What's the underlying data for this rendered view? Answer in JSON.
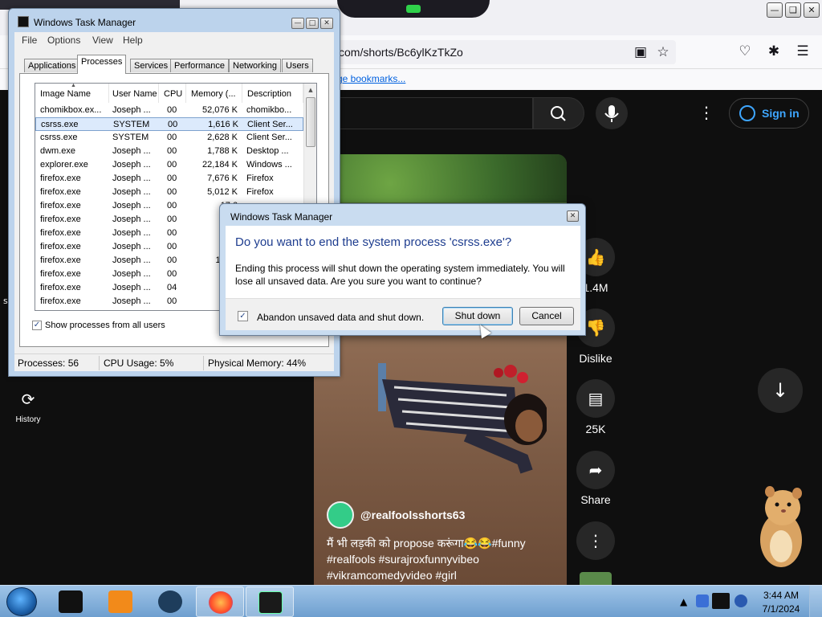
{
  "browser": {
    "url": "com/shorts/Bc6ylKzTkZo",
    "bookmarks_link": "ge bookmarks..."
  },
  "youtube": {
    "sign_in_label": "Sign in",
    "channel": "@realfoolsshorts63",
    "caption_lines": [
      "मैं भी लड़की को propose करूंगा😂😂#funny",
      "#realfools #surajroxfunnyvibeo",
      "#vikramcomedyvideo #girl"
    ],
    "actions": [
      {
        "icon": "like-icon",
        "label": "1.4M"
      },
      {
        "icon": "dislike-icon",
        "label": "Dislike"
      },
      {
        "icon": "comment-icon",
        "label": "25K"
      },
      {
        "icon": "share-icon",
        "label": "Share"
      },
      {
        "icon": "more-icon",
        "label": ""
      }
    ],
    "sidebar_history_label": "History"
  },
  "task_manager": {
    "title": "Windows Task Manager",
    "menu": [
      "File",
      "Options",
      "View",
      "Help"
    ],
    "tabs": [
      "Applications",
      "Processes",
      "Services",
      "Performance",
      "Networking",
      "Users"
    ],
    "active_tab": "Processes",
    "columns": [
      "Image Name",
      "User Name",
      "CPU",
      "Memory (...",
      "Description"
    ],
    "rows": [
      {
        "name": "chomikbox.ex...",
        "user": "Joseph ...",
        "cpu": "00",
        "mem": "52,076 K",
        "desc": "chomikbo..."
      },
      {
        "name": "csrss.exe",
        "user": "SYSTEM",
        "cpu": "00",
        "mem": "1,616 K",
        "desc": "Client Ser...",
        "selected": true
      },
      {
        "name": "csrss.exe",
        "user": "SYSTEM",
        "cpu": "00",
        "mem": "2,628 K",
        "desc": "Client Ser..."
      },
      {
        "name": "dwm.exe",
        "user": "Joseph ...",
        "cpu": "00",
        "mem": "1,788 K",
        "desc": "Desktop ..."
      },
      {
        "name": "explorer.exe",
        "user": "Joseph ...",
        "cpu": "00",
        "mem": "22,184 K",
        "desc": "Windows ..."
      },
      {
        "name": "firefox.exe",
        "user": "Joseph ...",
        "cpu": "00",
        "mem": "7,676 K",
        "desc": "Firefox"
      },
      {
        "name": "firefox.exe",
        "user": "Joseph ...",
        "cpu": "00",
        "mem": "5,012 K",
        "desc": "Firefox"
      },
      {
        "name": "firefox.exe",
        "user": "Joseph ...",
        "cpu": "00",
        "mem": "17,6",
        "desc": ""
      },
      {
        "name": "firefox.exe",
        "user": "Joseph ...",
        "cpu": "00",
        "mem": "3,6",
        "desc": ""
      },
      {
        "name": "firefox.exe",
        "user": "Joseph ...",
        "cpu": "00",
        "mem": "7,6",
        "desc": ""
      },
      {
        "name": "firefox.exe",
        "user": "Joseph ...",
        "cpu": "00",
        "mem": "26,7",
        "desc": ""
      },
      {
        "name": "firefox.exe",
        "user": "Joseph ...",
        "cpu": "00",
        "mem": "155,8",
        "desc": ""
      },
      {
        "name": "firefox.exe",
        "user": "Joseph ...",
        "cpu": "00",
        "mem": "15,2",
        "desc": ""
      },
      {
        "name": "firefox.exe",
        "user": "Joseph ...",
        "cpu": "04",
        "mem": "54,4",
        "desc": ""
      },
      {
        "name": "firefox.exe",
        "user": "Joseph ...",
        "cpu": "00",
        "mem": "3,7",
        "desc": ""
      }
    ],
    "show_all_label": "Show processes from all users",
    "status": {
      "processes": "Processes: 56",
      "cpu": "CPU Usage: 5%",
      "memory": "Physical Memory: 44%"
    }
  },
  "dialog": {
    "title": "Windows Task Manager",
    "heading": "Do you want to end the system process 'csrss.exe'?",
    "body_line1": "Ending this process will shut down the operating system immediately.  You will",
    "body_line2": "lose all unsaved data.  Are you sure you want to continue?",
    "checkbox_label": "Abandon unsaved data and shut down.",
    "checkbox_checked": true,
    "primary_button": "Shut down",
    "cancel_button": "Cancel"
  },
  "taskbar": {
    "time": "3:44 AM",
    "date": "7/1/2024"
  }
}
